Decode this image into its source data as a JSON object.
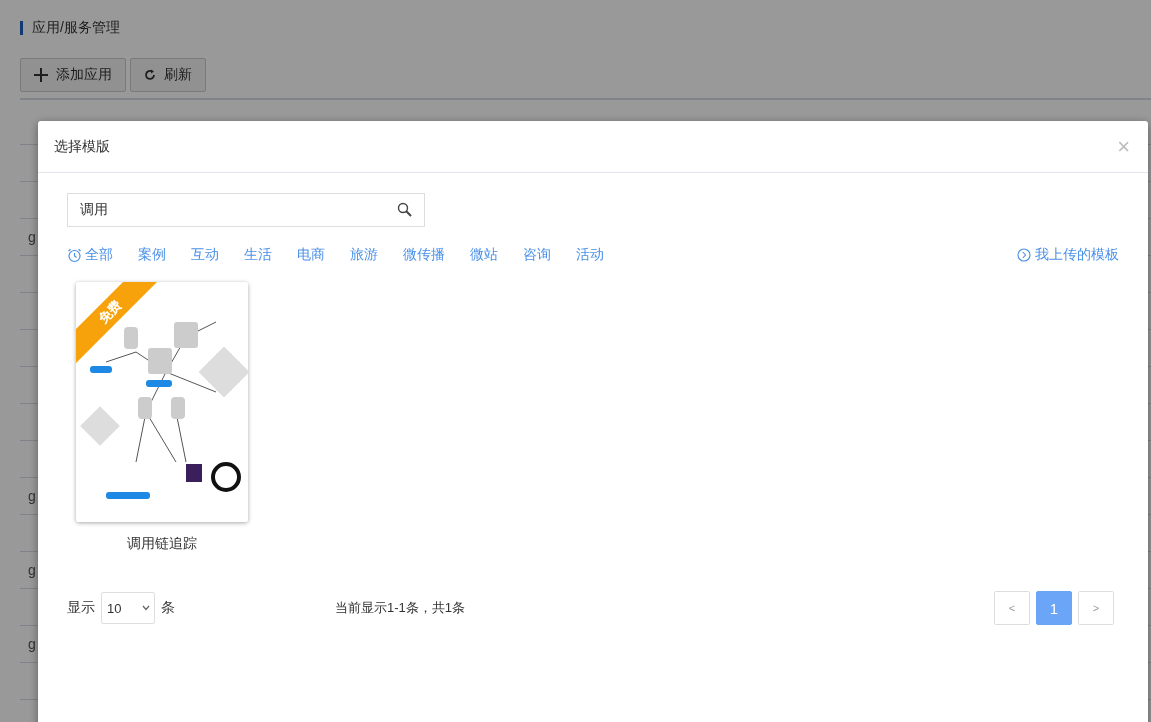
{
  "page": {
    "title": "应用/服务管理",
    "toolbar": [
      {
        "kind": "add",
        "label": "添加应用"
      },
      {
        "kind": "refresh",
        "label": "刷新"
      }
    ],
    "table": {
      "rows": [
        {},
        {},
        {
          "column_1": "g"
        },
        {},
        {},
        {},
        {},
        {},
        {},
        {
          "column_1": "g"
        },
        {},
        {
          "column_1": "g"
        },
        {},
        {
          "column_1": "g"
        },
        {}
      ]
    }
  },
  "dialog": {
    "title": "选择模版",
    "close": "×",
    "search": {
      "value": "调用"
    },
    "categories": [
      {
        "kind": "all",
        "label": "全部"
      },
      {
        "kind": "plain",
        "label": "案例"
      },
      {
        "kind": "plain",
        "label": "互动"
      },
      {
        "kind": "plain",
        "label": "生活"
      },
      {
        "kind": "plain",
        "label": "电商"
      },
      {
        "kind": "plain",
        "label": "旅游"
      },
      {
        "kind": "plain",
        "label": "微传播"
      },
      {
        "kind": "plain",
        "label": "微站"
      },
      {
        "kind": "plain",
        "label": "咨询"
      },
      {
        "kind": "plain",
        "label": "活动"
      }
    ],
    "my_templates": "我上传的模板",
    "templates": [
      {
        "name": "调用链追踪",
        "badge": "免费"
      }
    ],
    "footer": {
      "show_label": "显示",
      "page_size": "10",
      "unit": "条",
      "summary": "当前显示1-1条，共1条",
      "prev": "<",
      "next": ">",
      "pages": [
        {
          "label": "1",
          "selected": true
        }
      ]
    }
  }
}
